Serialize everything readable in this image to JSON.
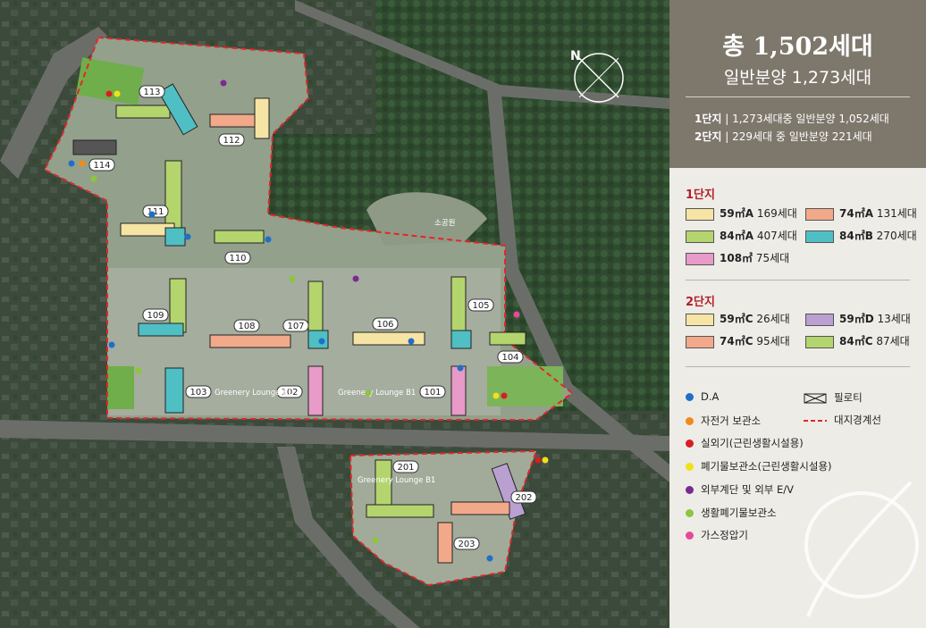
{
  "summary": {
    "total": "총 1,502세대",
    "general_sale": "일반분양 1,273세대",
    "complex1": {
      "name": "1단지",
      "detail": "1,273세대중 일반분양 1,052세대"
    },
    "complex2": {
      "name": "2단지",
      "detail": "229세대 중 일반분양 221세대"
    }
  },
  "legend_complex1": {
    "title": "1단지",
    "items": [
      {
        "type": "59㎡A",
        "count": "169세대",
        "color": "#f6e4a4"
      },
      {
        "type": "74㎡A",
        "count": "131세대",
        "color": "#f2a98a"
      },
      {
        "type": "84㎡A",
        "count": "407세대",
        "color": "#b4d46e"
      },
      {
        "type": "84㎡B",
        "count": "270세대",
        "color": "#4fbfc4"
      },
      {
        "type": "108㎡",
        "count": "75세대",
        "color": "#e89ac8"
      }
    ]
  },
  "legend_complex2": {
    "title": "2단지",
    "items": [
      {
        "type": "59㎡C",
        "count": "26세대",
        "color": "#f6e4a4"
      },
      {
        "type": "59㎡D",
        "count": "13세대",
        "color": "#b9a0d0"
      },
      {
        "type": "74㎡C",
        "count": "95세대",
        "color": "#f2a98a"
      },
      {
        "type": "84㎡C",
        "count": "87세대",
        "color": "#b4d46e"
      }
    ]
  },
  "symbols": [
    {
      "label": "D.A",
      "color": "#1f6fc8",
      "icon": "blue-dot"
    },
    {
      "label": "필로티",
      "icon": "pilotis-box"
    },
    {
      "label": "자전거 보관소",
      "color": "#f08a1e",
      "icon": "orange-dot"
    },
    {
      "label": "대지경계선",
      "color": "#e02828",
      "icon": "dashed-line"
    },
    {
      "label": "실외기(근린생활시설용)",
      "color": "#d81e24",
      "icon": "red-dot"
    },
    {
      "label": "폐기물보관소(근린생활시설용)",
      "color": "#f2e01a",
      "icon": "yellow-dot"
    },
    {
      "label": "외부계단 및 외부 E/V",
      "color": "#7a2a90",
      "icon": "purple-dot"
    },
    {
      "label": "생활폐기물보관소",
      "color": "#8cc63e",
      "icon": "green-dot"
    },
    {
      "label": "가스정압기",
      "color": "#e8489a",
      "icon": "pink-dot"
    }
  ],
  "buildings": [
    "113",
    "112",
    "114",
    "111",
    "110",
    "109",
    "108",
    "107",
    "106",
    "105",
    "104",
    "103",
    "102",
    "101",
    "201",
    "202",
    "203"
  ],
  "area_labels": {
    "greenery_b1_a": "Greenery Lounge B1",
    "greenery_b1_b": "Greenery Lounge B1",
    "greenery_b1_c": "Greenery Lounge B1",
    "park": "소공원"
  },
  "compass": "N"
}
